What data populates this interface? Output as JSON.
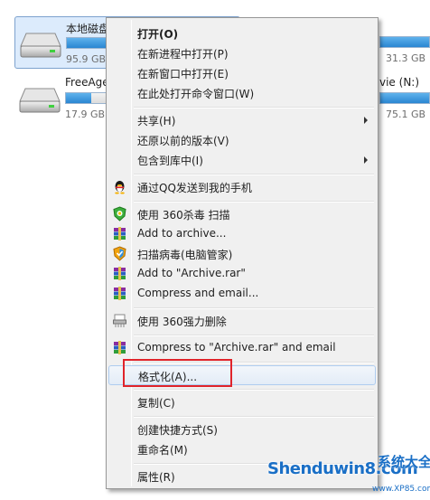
{
  "drives": [
    {
      "name": "本地磁盘",
      "size_text": "95.9 GB",
      "fill_fraction": 0.55,
      "selected": true
    },
    {
      "name": "FreeAge",
      "size_text": "17.9 GB",
      "fill_fraction": 0.15,
      "selected": false
    }
  ],
  "right_fragments": {
    "row1_size": "31.3 GB",
    "row2_name": "vie (N:)",
    "row2_size": "75.1 GB"
  },
  "context_menu": {
    "items": [
      {
        "id": "open",
        "label": "打开(O)",
        "bold": true
      },
      {
        "id": "open-new-process",
        "label": "在新进程中打开(P)"
      },
      {
        "id": "open-new-window",
        "label": "在新窗口中打开(E)"
      },
      {
        "id": "open-cmd-here",
        "label": "在此处打开命令窗口(W)"
      },
      {
        "id": "share",
        "label": "共享(H)",
        "submenu": true
      },
      {
        "id": "restore-previous",
        "label": "还原以前的版本(V)"
      },
      {
        "id": "include-in-library",
        "label": "包含到库中(I)",
        "submenu": true
      },
      {
        "id": "send-qq",
        "label": "通过QQ发送到我的手机",
        "icon": "qq-penguin-icon"
      },
      {
        "id": "scan-360",
        "label": "使用 360杀毒 扫描",
        "icon": "shield-360-icon"
      },
      {
        "id": "add-archive",
        "label": "Add to archive...",
        "icon": "winrar-books-icon"
      },
      {
        "id": "scan-pc-manager",
        "label": "扫描病毒(电脑管家)",
        "icon": "pc-manager-shield-icon"
      },
      {
        "id": "add-archive-rar",
        "label": "Add to \"Archive.rar\"",
        "icon": "winrar-books-icon"
      },
      {
        "id": "compress-email",
        "label": "Compress and email...",
        "icon": "winrar-books-icon"
      },
      {
        "id": "force-delete-360",
        "label": "使用 360强力删除",
        "icon": "shredder-icon"
      },
      {
        "id": "compress-rar-email",
        "label": "Compress to \"Archive.rar\" and email",
        "icon": "winrar-books-icon"
      },
      {
        "id": "format",
        "label": "格式化(A)...",
        "highlighted": true
      },
      {
        "id": "copy",
        "label": "复制(C)"
      },
      {
        "id": "create-shortcut",
        "label": "创建快捷方式(S)"
      },
      {
        "id": "rename",
        "label": "重命名(M)"
      },
      {
        "id": "properties",
        "label": "属性(R)"
      }
    ]
  },
  "watermark": {
    "main": "Shenduwin8.com",
    "cn": "系统大全",
    "url": "www.XP85.com"
  },
  "colors": {
    "highlight_box": "#e0242b",
    "menu_bg": "#f0f0f0",
    "selection_bg": "#dcebfc",
    "watermark_blue": "#1a6fc6"
  }
}
